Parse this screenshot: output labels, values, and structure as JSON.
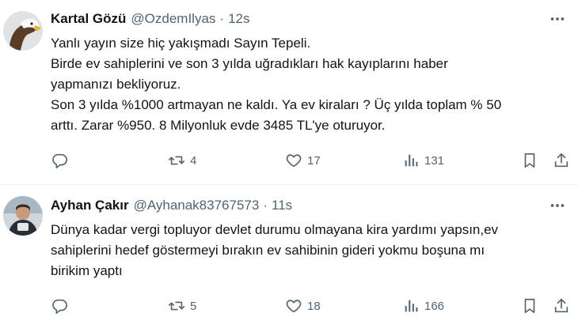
{
  "tweets": [
    {
      "name": "Kartal Gözü",
      "handle": "@OzdemIlyas",
      "separator": "·",
      "time": "12s",
      "lines": [
        "Yanlı yayın size hiç yakışmadı Sayın Tepeli.",
        "Birde ev sahiplerini ve son 3 yılda uğradıkları hak kayıplarını haber",
        "yapmanızı bekliyoruz.",
        "Son 3 yılda %1000 artmayan ne kaldı. Ya ev kiraları ? Üç yılda toplam % 50",
        "arttı. Zarar %950.  8 Milyonluk evde 3485 TL'ye oturuyor."
      ],
      "retweets": "4",
      "likes": "17",
      "views": "131"
    },
    {
      "name": "Ayhan Çakır",
      "handle": "@Ayhanak83767573",
      "separator": "·",
      "time": "11s",
      "lines": [
        "Dünya kadar vergi topluyor devlet durumu olmayana kira yardımı yapsın,ev",
        "sahiplerini hedef göstermeyi bırakın ev sahibinin gideri yokmu boşuna mı",
        "birikim yaptı"
      ],
      "retweets": "5",
      "likes": "18",
      "views": "166"
    }
  ],
  "colors": {
    "text": "#0f1419",
    "secondary": "#536471",
    "divider": "#eff3f4"
  },
  "icons": [
    "eagle-avatar",
    "user-avatar",
    "more-icon",
    "reply-icon",
    "retweet-icon",
    "like-icon",
    "views-icon",
    "bookmark-icon",
    "share-icon"
  ]
}
